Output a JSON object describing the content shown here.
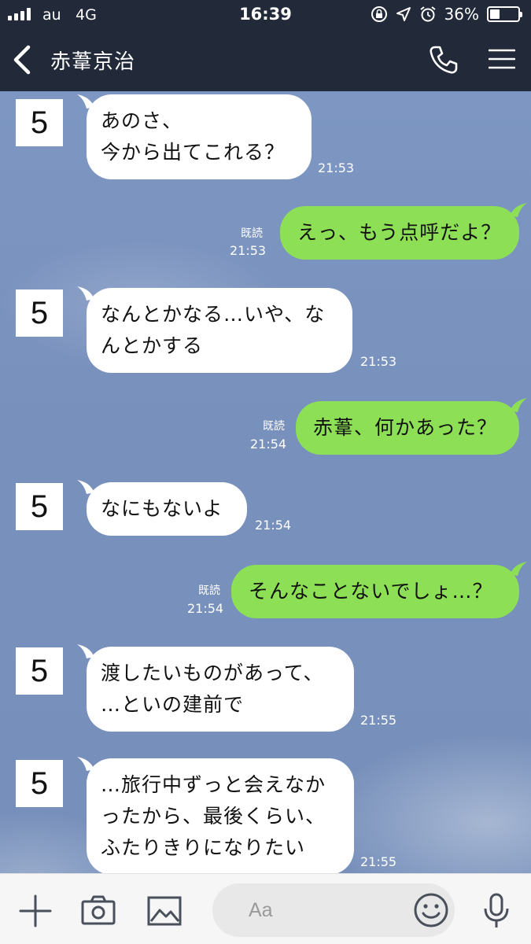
{
  "status_bar": {
    "carrier": "au",
    "network": "4G",
    "time": "16:39",
    "battery_percent": "36%",
    "battery_level": 0.36
  },
  "nav": {
    "title": "赤葦京治",
    "icons": [
      "back-chevron-icon",
      "phone-icon",
      "menu-icon"
    ]
  },
  "messages": [
    {
      "side": "left",
      "avatar": "5",
      "text": "あのさ、\n今から出てこれる？",
      "time": "21:53"
    },
    {
      "side": "right",
      "read": "既読",
      "text": "えっ、もう点呼だよ？",
      "time": "21:53"
    },
    {
      "side": "left",
      "avatar": "5",
      "text": "なんとかなる…いや、な\nんとかする",
      "time": "21:53"
    },
    {
      "side": "right",
      "read": "既読",
      "text": "赤葦、何かあった？",
      "time": "21:54"
    },
    {
      "side": "left",
      "avatar": "5",
      "text": "なにもないよ",
      "time": "21:54"
    },
    {
      "side": "right",
      "read": "既読",
      "text": "そんなことないでしょ…？",
      "time": "21:54"
    },
    {
      "side": "left",
      "avatar": "5",
      "text": "渡したいものがあって、\n…といの建前で",
      "time": "21:55"
    },
    {
      "side": "left",
      "avatar": "5",
      "text": "…旅行中ずっと会えなか\nったから、最後くらい、\nふたりきりになりたい",
      "time": "21:55"
    }
  ],
  "input_bar": {
    "placeholder": "Aa",
    "icons": [
      "plus-icon",
      "camera-icon",
      "image-icon",
      "emoji-icon",
      "microphone-icon"
    ]
  },
  "colors": {
    "header": "#222a3a",
    "chat_background": "#7b93bf",
    "outgoing_bubble": "#8de055",
    "incoming_bubble": "#ffffff"
  }
}
